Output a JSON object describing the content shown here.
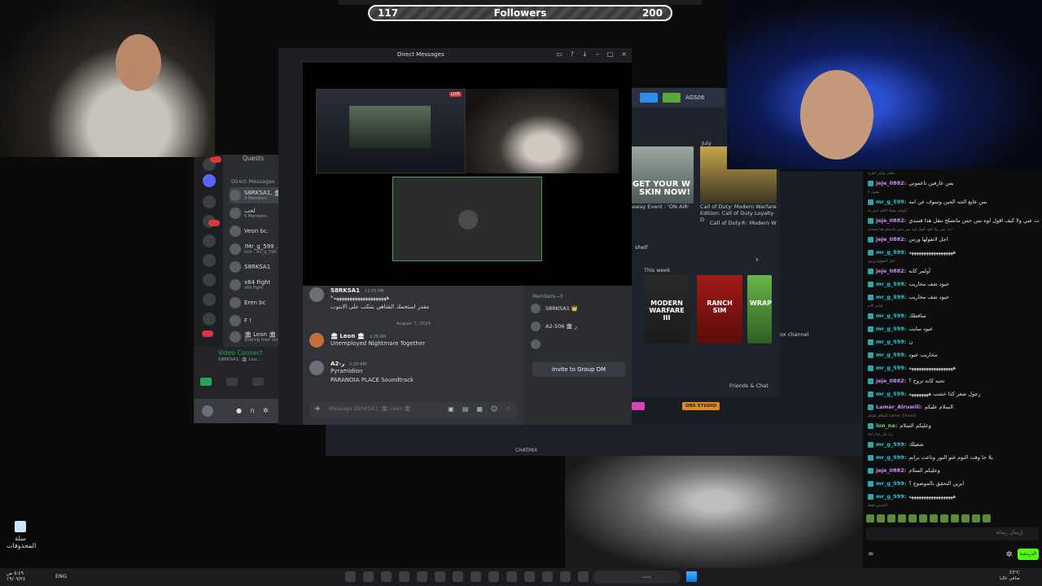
{
  "overlay": {
    "followers_label": "Followers",
    "current": "117",
    "goal": "200"
  },
  "discord": {
    "window_title": "Direct Messages",
    "live_badge": "LIVE",
    "quests_label": "Quests",
    "dm_header": "Direct Messages",
    "dms": [
      {
        "name": "S8RKSA1, 🏛 I...",
        "sub": "3 Members"
      },
      {
        "name": "لحب",
        "sub": "5 Members"
      },
      {
        "name": "Veon bc.",
        "sub": ""
      },
      {
        "name": "!Mr_g_599 ...",
        "sub": "kick : mr_g_599"
      },
      {
        "name": "S8RKSA1",
        "sub": ""
      },
      {
        "name": "x64 Fight",
        "sub": "x64 Fight"
      },
      {
        "name": "Eren bc",
        "sub": ""
      },
      {
        "name": "F !",
        "sub": ""
      },
      {
        "name": "🏛 Leon 🏛",
        "sub": "Sharing their scre..."
      }
    ],
    "voice": {
      "status": "Video Connect",
      "sub": "S8RKSA1, 🏛 Leo..."
    },
    "messages": [
      {
        "author": "S8RKSA1",
        "time": "11:05 PM",
        "lines": [
          "*ههههههههههههههههههههه",
          "مقدر استحمك الشاهي بتنكب على الابتوب"
        ]
      },
      {
        "author": "🏛 Leon 🏛",
        "time": "1:28 AM",
        "lines": [
          "Unemployed Nightmare Together"
        ]
      },
      {
        "author": "A2-ر",
        "time": "1:30 AM",
        "lines": [
          "Pyramidion",
          "PARANOIA PLACE Soundtrack"
        ]
      }
    ],
    "date_divider": "August 7, 2024",
    "message_placeholder": "Message S8RKSA1, 🏛 Leon 🏛",
    "members_header": "Members—3",
    "members": [
      {
        "name": "S8RKSA1 👑"
      },
      {
        "name": "A2-ر 🏛 506"
      },
      {
        "name": ""
      }
    ],
    "invite_button": "Invite to Group DM"
  },
  "store": {
    "username": "AGS06",
    "promo_text": "GET YOUR W SKIN NOW!",
    "promo_caption": "away Event : 'ON AIR'",
    "promo2_caption": "Call of Duty: Modern Warfare Edition: Call of Duty Loyalty D",
    "promo2_sub": "Call of Duty®: Modern W",
    "month": "July",
    "this_week": "This week",
    "shelf": "shelf",
    "games": [
      "MODERN WARFARE III",
      "RANCH SIM",
      "WRAP"
    ],
    "friends_chat": "Friends & Chat",
    "box_channel": "ox channel",
    "obs_label": "OBS STUDIO",
    "chatmix_label": "CHATMIX"
  },
  "chat": {
    "lines": [
      {
        "sys": true,
        "text": "ماقدر ولكن اطرح"
      },
      {
        "user": "jeje_0882:",
        "text": "بس عارفين ناعموني",
        "c": "p"
      },
      {
        "sys": true,
        "text": "بيقول لا"
      },
      {
        "user": "mr_g_599:",
        "text": "بس عايع الجه الحين وسوف عن امه"
      },
      {
        "sys": true,
        "text": "الهبايه بيقولا الكود ايش اه"
      },
      {
        "user": "jeje_0882:",
        "text": "انت عبي ولا كيف اقول لوه بس حس ماتصلح نتقل هذا قسدي",
        "c": "p"
      },
      {
        "sys": true,
        "text": "انت عبي ولا كيف اقول لوه بس حس ماتصلح هذا قسدي"
      },
      {
        "user": "jeje_0882:",
        "text": "اجل لاتقولها ورس",
        "c": "p"
      },
      {
        "user": "mr_g_599:",
        "text": "ههههههههههههههههههه"
      },
      {
        "sys": true,
        "text": "اجل لاتقولها ورس"
      },
      {
        "user": "jeje_0882:",
        "text": "أولمر كانه",
        "c": "p"
      },
      {
        "user": "mr_g_599:",
        "text": "خيود شف مخاريب"
      },
      {
        "user": "mr_g_599:",
        "text": "خيود شف مخاريب"
      },
      {
        "sys": true,
        "text": "أوامر كانه"
      },
      {
        "user": "mr_g_599:",
        "text": "ساقطك"
      },
      {
        "user": "mr_g_599:",
        "text": "عيود سايب"
      },
      {
        "user": "mr_g_599:",
        "text": "ن"
      },
      {
        "user": "mr_g_599:",
        "text": "مخاريب عيود"
      },
      {
        "user": "mr_g_599:",
        "text": "ههههههههههههههههههه"
      },
      {
        "user": "jeje_0882:",
        "text": "تحبه كانه تروح ؟",
        "c": "p"
      },
      {
        "user": "mr_g_599:",
        "text": "رجول صغر كذا خشب ههههههههه"
      },
      {
        "user": "Lamar_Alruwili:",
        "text": "السلام عليكم",
        "c": "p"
      },
      {
        "sys": true,
        "text": "السلام عليكم Lamar_Alruwili"
      },
      {
        "user": "lon_na:",
        "text": "وعليكم السلام",
        "c": "g"
      },
      {
        "sys": true,
        "text": "lon_na ردا على"
      },
      {
        "user": "mr_g_599:",
        "text": "شغيلك"
      },
      {
        "user": "mr_g_599:",
        "text": "يلا جا وقت النوم غنو النور وناعت برانم"
      },
      {
        "user": "jeje_0882:",
        "text": "وعليكم السلام",
        "c": "p"
      },
      {
        "user": "mr_g_599:",
        "text": "ابرين التحقق بالموضوع ؟"
      },
      {
        "user": "mr_g_599:",
        "text": "ههههههههههههههههههه"
      }
    ],
    "input_placeholder": "إرسال رسالة",
    "send_label": "الدردشة",
    "pinned_label": "المثبتين فقط"
  },
  "desktop": {
    "icon_label": "سلة المحذوفات"
  },
  "taskbar": {
    "lang": "ENG",
    "time": "٥:٤٩ ص",
    "date": "١٩/٠٧/٢٤",
    "search_placeholder": "بحث",
    "weather_temp": "33°C",
    "weather_desc": "صافي غالبا"
  }
}
